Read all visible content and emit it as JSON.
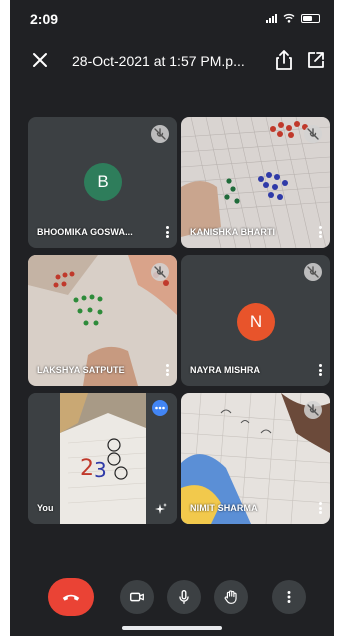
{
  "status_bar": {
    "time": "2:09"
  },
  "top_bar": {
    "title": "28-Oct-2021 at 1:57 PM.p..."
  },
  "participants": [
    {
      "name": "BHOOMIKA GOSWA...",
      "initial": "B",
      "avatar_color": "#2e7d5b",
      "muted": true,
      "video": false
    },
    {
      "name": "KANISHKA BHARTI",
      "muted": true,
      "video": true
    },
    {
      "name": "LAKSHYA SATPUTE",
      "muted": true,
      "video": true
    },
    {
      "name": "NAYRA MISHRA",
      "initial": "N",
      "avatar_color": "#e8542b",
      "muted": true,
      "video": false
    },
    {
      "name": "You",
      "muted": false,
      "video": true
    },
    {
      "name": "NIMIT SHARMA",
      "muted": true,
      "video": true
    }
  ],
  "controls": {
    "end_call_color": "#ea4335",
    "buttons": [
      "end-call-icon",
      "camera-icon",
      "microphone-icon",
      "raise-hand-icon",
      "more-options-icon"
    ]
  }
}
